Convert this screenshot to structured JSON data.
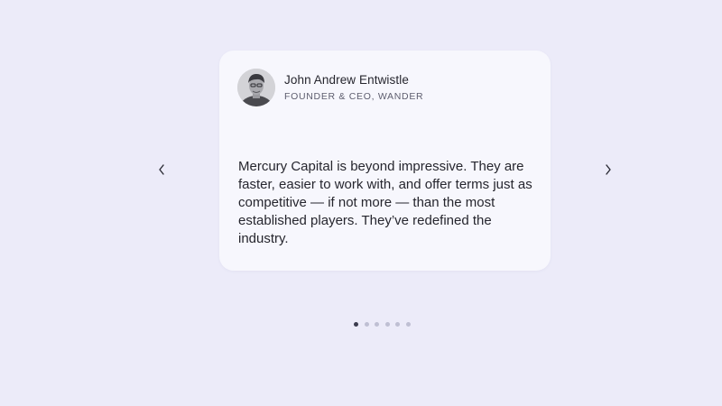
{
  "testimonial": {
    "author_name": "John Andrew Entwistle",
    "author_title": "FOUNDER & CEO, WANDER",
    "quote": "Mercury Capital is beyond impressive. They are faster, easier to work with, and offer terms just as competitive — if not more — than the most established players. They’ve redefined the industry.",
    "avatar_icon": "person-photo"
  },
  "carousel": {
    "prev_icon": "chevron-left-icon",
    "next_icon": "chevron-right-icon",
    "slide_count": 6,
    "active_index": 0
  },
  "colors": {
    "background": "#ecebf9",
    "card": "#f7f7fd",
    "text": "#26262e",
    "muted": "#5d5d6e",
    "dot_active": "#3b3b4e",
    "dot_inactive": "#bfbfd3"
  }
}
